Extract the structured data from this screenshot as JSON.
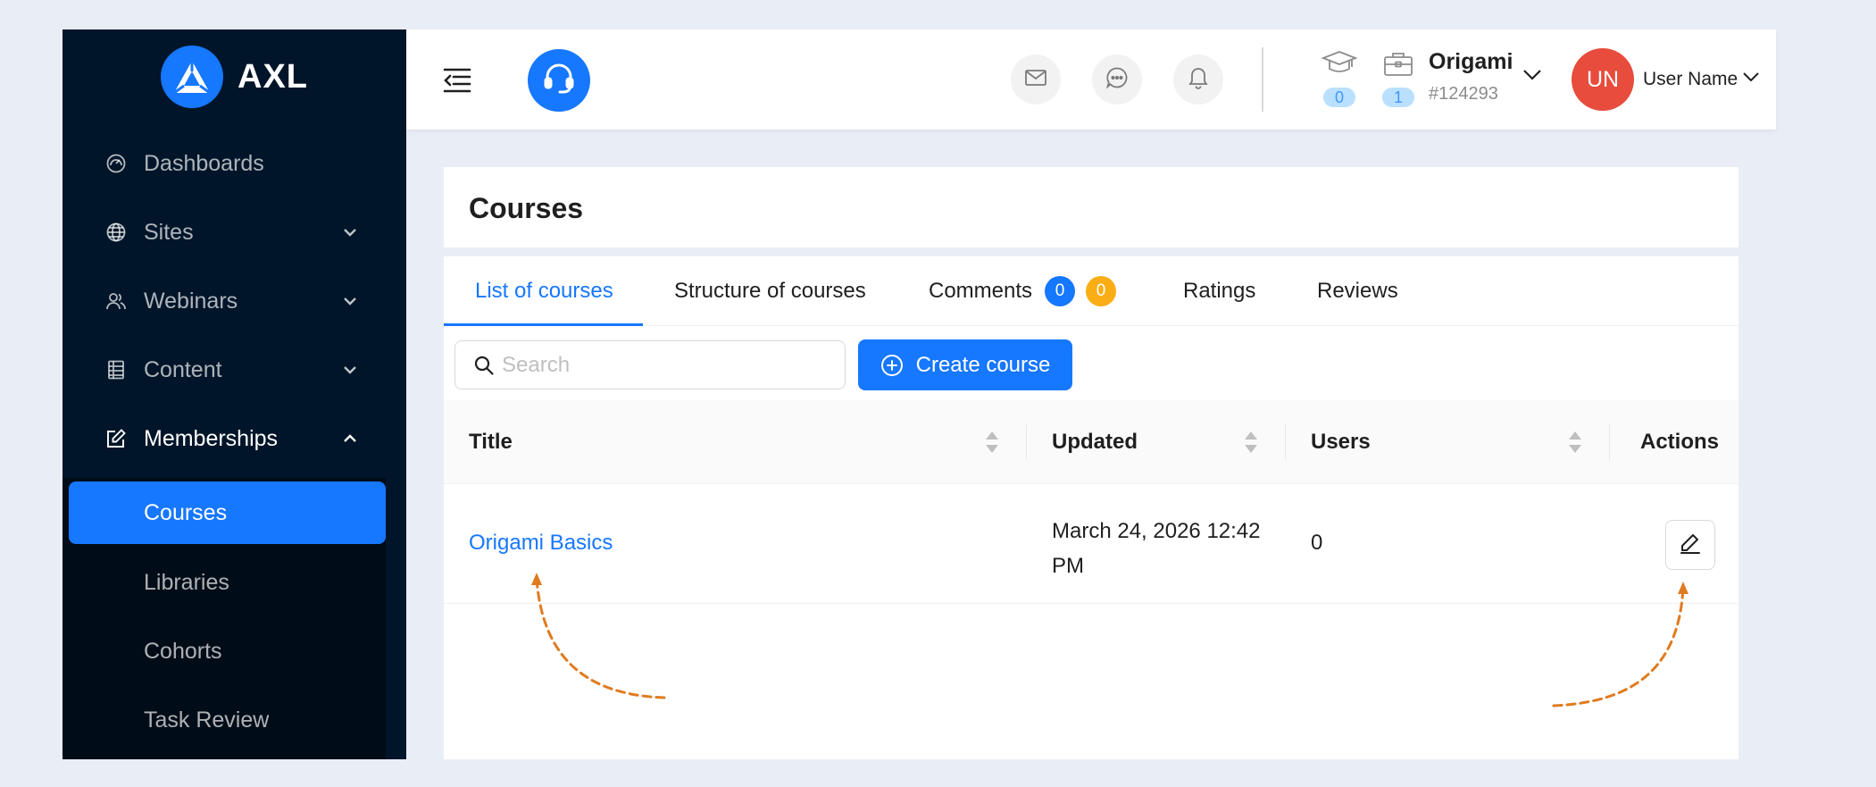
{
  "brand": {
    "name": "AXL",
    "color": "#1677ff"
  },
  "sidebar": {
    "items": [
      {
        "label": "Dashboards",
        "icon": "dashboard-icon"
      },
      {
        "label": "Sites",
        "icon": "globe-icon"
      },
      {
        "label": "Webinars",
        "icon": "users-icon"
      },
      {
        "label": "Content",
        "icon": "content-icon"
      },
      {
        "label": "Memberships",
        "icon": "edit-square-icon"
      }
    ],
    "memberships_children": [
      {
        "label": "Courses",
        "selected": true
      },
      {
        "label": "Libraries"
      },
      {
        "label": "Cohorts"
      },
      {
        "label": "Task Review"
      }
    ]
  },
  "header": {
    "counters": [
      {
        "icon": "graduation-cap-icon",
        "count": "0"
      },
      {
        "icon": "briefcase-icon",
        "count": "1"
      }
    ],
    "account": {
      "name": "Origami",
      "id": "#124293"
    },
    "user": {
      "initials": "UN",
      "name": "User Name",
      "avatar_color": "#e74c3c"
    }
  },
  "page": {
    "title": "Courses"
  },
  "tabs": [
    {
      "label": "List of courses",
      "active": true
    },
    {
      "label": "Structure of courses"
    },
    {
      "label": "Comments",
      "badges": [
        "0",
        "0"
      ]
    },
    {
      "label": "Ratings"
    },
    {
      "label": "Reviews"
    }
  ],
  "toolbar": {
    "search_placeholder": "Search",
    "search_value": "",
    "create_label": "Create course"
  },
  "table": {
    "columns": [
      "Title",
      "Updated",
      "Users",
      "Actions"
    ],
    "rows": [
      {
        "title": "Origami Basics",
        "updated_line1": "March 24, 2026 12:42",
        "updated_line2": "PM",
        "users": "0"
      }
    ]
  },
  "colors": {
    "sidebar_bg": "#001529",
    "submenu_bg": "#000c17",
    "primary": "#1677ff",
    "warning": "#faad14",
    "annotation": "#e07b1f"
  }
}
